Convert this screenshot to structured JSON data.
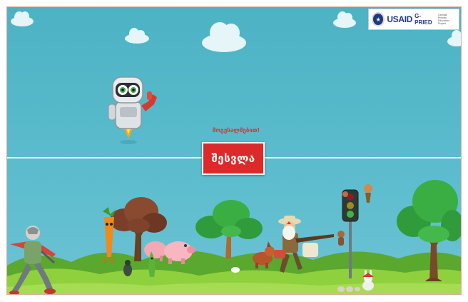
{
  "logo": {
    "brand": "USAID",
    "program": "G-PRIED",
    "subtitle": "Georgia Primary Education Project"
  },
  "welcome_text": "მოგესალმებით!",
  "enter_button": {
    "label": "შესვლა"
  },
  "colors": {
    "sky": "#4fb6c6",
    "button": "#dc2a2a",
    "grass_dark": "#5aa82e",
    "grass_light": "#8fd03d"
  },
  "scene": {
    "characters": [
      "robot-icon",
      "grandfather-icon",
      "carrot-icon",
      "pig-icon",
      "hunter-icon",
      "traffic-light-icon",
      "tree-icon",
      "cloud-icon"
    ]
  }
}
